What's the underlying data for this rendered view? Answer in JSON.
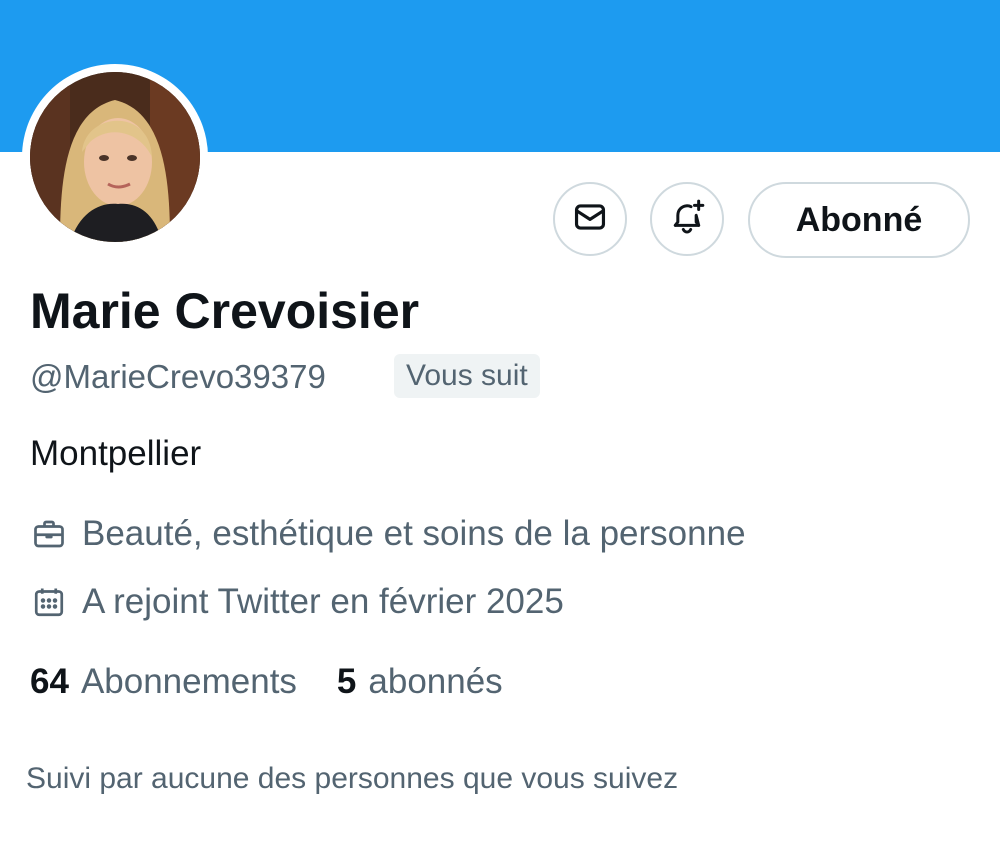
{
  "profile": {
    "display_name": "Marie Crevoisier",
    "handle": "@MarieCrevo39379",
    "follows_you_badge": "Vous suit",
    "bio": "Montpellier",
    "category": "Beauté, esthétique et soins de la personne",
    "joined": "A rejoint Twitter en février 2025"
  },
  "stats": {
    "following_count": "64",
    "following_label": "Abonnements",
    "followers_count": "5",
    "followers_label": "abonnés"
  },
  "actions": {
    "message_icon": "envelope-icon",
    "notify_icon": "bell-plus-icon",
    "follow_label": "Abonné"
  },
  "icons": {
    "category": "briefcase-icon",
    "joined": "calendar-icon"
  },
  "followed_by_text": "Suivi par aucune des personnes que vous suivez",
  "colors": {
    "banner": "#1d9bf0",
    "text_primary": "#0f1419",
    "text_secondary": "#536471",
    "border": "#cfd9de",
    "badge_bg": "#eff3f4"
  }
}
